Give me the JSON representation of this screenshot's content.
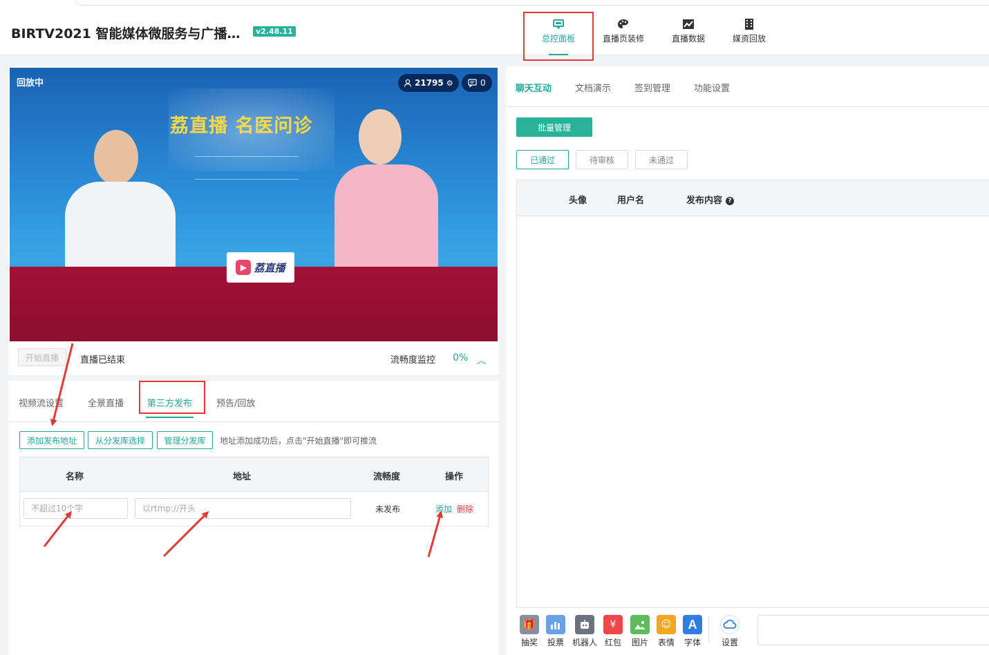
{
  "header": {
    "app_title": "BIRTV2021 智能媒体微服务与广播…",
    "version": "v2.48.11",
    "nav": [
      {
        "label": "总控面板",
        "icon": "monitor-icon",
        "active": true
      },
      {
        "label": "直播页装修",
        "icon": "palette-icon"
      },
      {
        "label": "直播数据",
        "icon": "chart-icon"
      },
      {
        "label": "媒资回放",
        "icon": "film-icon"
      }
    ]
  },
  "video": {
    "status_badge": "回放中",
    "viewer_count": "21795",
    "comment_count": "0",
    "banner_text": "荔直播 名医问诊",
    "sign_text": "荔直播",
    "start_button": "开始直播",
    "live_status": "直播已结束",
    "fluency_label": "流畅度监控",
    "fluency_value": "0%"
  },
  "publish": {
    "tabs": [
      "视频流设置",
      "全景直播",
      "第三方发布",
      "预告/回放"
    ],
    "active_tab": "第三方发布",
    "buttons": {
      "add_address": "添加发布地址",
      "from_library": "从分发库选择",
      "manage_library": "管理分发库"
    },
    "hint": "地址添加成功后，点击\"开始直播\"即可推流",
    "table": {
      "headers": [
        "名称",
        "地址",
        "流畅度",
        "操作"
      ],
      "row": {
        "name_placeholder": "不超过10个字",
        "address_placeholder": "以rtmp://开头",
        "status": "未发布",
        "add_action": "添加",
        "delete_action": "删除"
      }
    }
  },
  "chat": {
    "tabs": [
      "聊天互动",
      "文档演示",
      "签到管理",
      "功能设置"
    ],
    "active_tab": "聊天互动",
    "batch_button": "批量管理",
    "filters": [
      "已通过",
      "待审核",
      "未通过"
    ],
    "active_filter": "已通过",
    "columns": [
      "头像",
      "用户名",
      "发布内容"
    ],
    "tools": [
      {
        "label": "抽奖",
        "icon": "gift-icon",
        "color": "#8a8f99"
      },
      {
        "label": "投票",
        "icon": "vote-icon",
        "color": "#6aa2e8"
      },
      {
        "label": "机器人",
        "icon": "robot-icon",
        "color": "#6b7280"
      },
      {
        "label": "红包",
        "icon": "red-packet-icon",
        "color": "#f04848"
      },
      {
        "label": "图片",
        "icon": "image-icon",
        "color": "#5dbb5d"
      },
      {
        "label": "表情",
        "icon": "emoji-icon",
        "color": "#f5a623"
      },
      {
        "label": "字体",
        "icon": "font-icon",
        "color": "#2f7de1"
      },
      {
        "label": "设置",
        "icon": "settings-cloud-icon",
        "color": "#2f7de1"
      }
    ]
  },
  "colors": {
    "accent": "#26a69a",
    "highlight_box": "#e53935",
    "delete": "#e53935"
  }
}
